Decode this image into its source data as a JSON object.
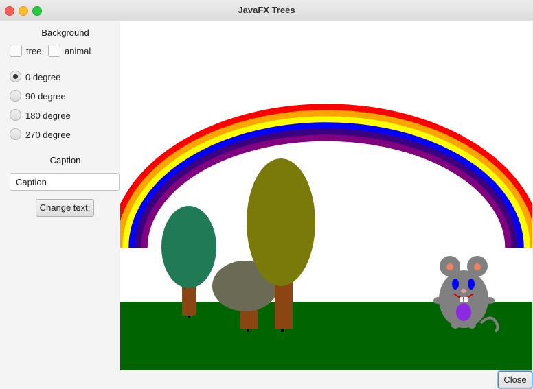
{
  "window": {
    "title": "JavaFX Trees"
  },
  "background_section": {
    "heading": "Background",
    "checkboxes": [
      {
        "label": "tree",
        "checked": false
      },
      {
        "label": "animal",
        "checked": false
      }
    ]
  },
  "rotation": {
    "options": [
      {
        "label": "0 degree",
        "selected": true
      },
      {
        "label": "90 degree",
        "selected": false
      },
      {
        "label": "180 degree",
        "selected": false
      },
      {
        "label": "270 degree",
        "selected": false
      }
    ]
  },
  "caption_section": {
    "heading": "Caption",
    "input_value": "Caption",
    "change_button_label": "Change text:"
  },
  "footer": {
    "close_label": "Close"
  },
  "scene": {
    "rainbow_colors": [
      "#ff0000",
      "#ffa500",
      "#ffff00",
      "#0000ff",
      "#3a007d",
      "#800080"
    ],
    "grass_color": "#006400",
    "trunk_color": "#8b4513",
    "tree_colors": [
      "#1f7a55",
      "#6b6b55",
      "#7a7a0a"
    ],
    "mouse_body_color": "#808080",
    "mouse_ear_inner_color": "#f08060",
    "mouse_eye_color": "#0000ff",
    "mouse_belly_color": "#8a2be2"
  }
}
